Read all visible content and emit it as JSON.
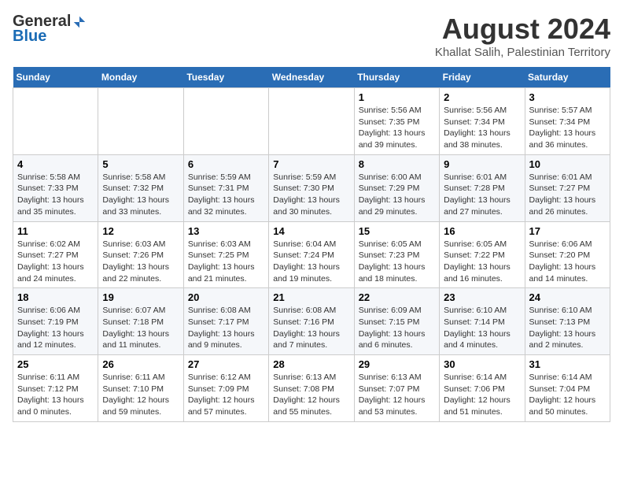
{
  "logo": {
    "general": "General",
    "blue": "Blue"
  },
  "header": {
    "month_title": "August 2024",
    "location": "Khallat Salih, Palestinian Territory"
  },
  "weekdays": [
    "Sunday",
    "Monday",
    "Tuesday",
    "Wednesday",
    "Thursday",
    "Friday",
    "Saturday"
  ],
  "weeks": [
    [
      {
        "day": "",
        "info": ""
      },
      {
        "day": "",
        "info": ""
      },
      {
        "day": "",
        "info": ""
      },
      {
        "day": "",
        "info": ""
      },
      {
        "day": "1",
        "info": "Sunrise: 5:56 AM\nSunset: 7:35 PM\nDaylight: 13 hours\nand 39 minutes."
      },
      {
        "day": "2",
        "info": "Sunrise: 5:56 AM\nSunset: 7:34 PM\nDaylight: 13 hours\nand 38 minutes."
      },
      {
        "day": "3",
        "info": "Sunrise: 5:57 AM\nSunset: 7:34 PM\nDaylight: 13 hours\nand 36 minutes."
      }
    ],
    [
      {
        "day": "4",
        "info": "Sunrise: 5:58 AM\nSunset: 7:33 PM\nDaylight: 13 hours\nand 35 minutes."
      },
      {
        "day": "5",
        "info": "Sunrise: 5:58 AM\nSunset: 7:32 PM\nDaylight: 13 hours\nand 33 minutes."
      },
      {
        "day": "6",
        "info": "Sunrise: 5:59 AM\nSunset: 7:31 PM\nDaylight: 13 hours\nand 32 minutes."
      },
      {
        "day": "7",
        "info": "Sunrise: 5:59 AM\nSunset: 7:30 PM\nDaylight: 13 hours\nand 30 minutes."
      },
      {
        "day": "8",
        "info": "Sunrise: 6:00 AM\nSunset: 7:29 PM\nDaylight: 13 hours\nand 29 minutes."
      },
      {
        "day": "9",
        "info": "Sunrise: 6:01 AM\nSunset: 7:28 PM\nDaylight: 13 hours\nand 27 minutes."
      },
      {
        "day": "10",
        "info": "Sunrise: 6:01 AM\nSunset: 7:27 PM\nDaylight: 13 hours\nand 26 minutes."
      }
    ],
    [
      {
        "day": "11",
        "info": "Sunrise: 6:02 AM\nSunset: 7:27 PM\nDaylight: 13 hours\nand 24 minutes."
      },
      {
        "day": "12",
        "info": "Sunrise: 6:03 AM\nSunset: 7:26 PM\nDaylight: 13 hours\nand 22 minutes."
      },
      {
        "day": "13",
        "info": "Sunrise: 6:03 AM\nSunset: 7:25 PM\nDaylight: 13 hours\nand 21 minutes."
      },
      {
        "day": "14",
        "info": "Sunrise: 6:04 AM\nSunset: 7:24 PM\nDaylight: 13 hours\nand 19 minutes."
      },
      {
        "day": "15",
        "info": "Sunrise: 6:05 AM\nSunset: 7:23 PM\nDaylight: 13 hours\nand 18 minutes."
      },
      {
        "day": "16",
        "info": "Sunrise: 6:05 AM\nSunset: 7:22 PM\nDaylight: 13 hours\nand 16 minutes."
      },
      {
        "day": "17",
        "info": "Sunrise: 6:06 AM\nSunset: 7:20 PM\nDaylight: 13 hours\nand 14 minutes."
      }
    ],
    [
      {
        "day": "18",
        "info": "Sunrise: 6:06 AM\nSunset: 7:19 PM\nDaylight: 13 hours\nand 12 minutes."
      },
      {
        "day": "19",
        "info": "Sunrise: 6:07 AM\nSunset: 7:18 PM\nDaylight: 13 hours\nand 11 minutes."
      },
      {
        "day": "20",
        "info": "Sunrise: 6:08 AM\nSunset: 7:17 PM\nDaylight: 13 hours\nand 9 minutes."
      },
      {
        "day": "21",
        "info": "Sunrise: 6:08 AM\nSunset: 7:16 PM\nDaylight: 13 hours\nand 7 minutes."
      },
      {
        "day": "22",
        "info": "Sunrise: 6:09 AM\nSunset: 7:15 PM\nDaylight: 13 hours\nand 6 minutes."
      },
      {
        "day": "23",
        "info": "Sunrise: 6:10 AM\nSunset: 7:14 PM\nDaylight: 13 hours\nand 4 minutes."
      },
      {
        "day": "24",
        "info": "Sunrise: 6:10 AM\nSunset: 7:13 PM\nDaylight: 13 hours\nand 2 minutes."
      }
    ],
    [
      {
        "day": "25",
        "info": "Sunrise: 6:11 AM\nSunset: 7:12 PM\nDaylight: 13 hours\nand 0 minutes."
      },
      {
        "day": "26",
        "info": "Sunrise: 6:11 AM\nSunset: 7:10 PM\nDaylight: 12 hours\nand 59 minutes."
      },
      {
        "day": "27",
        "info": "Sunrise: 6:12 AM\nSunset: 7:09 PM\nDaylight: 12 hours\nand 57 minutes."
      },
      {
        "day": "28",
        "info": "Sunrise: 6:13 AM\nSunset: 7:08 PM\nDaylight: 12 hours\nand 55 minutes."
      },
      {
        "day": "29",
        "info": "Sunrise: 6:13 AM\nSunset: 7:07 PM\nDaylight: 12 hours\nand 53 minutes."
      },
      {
        "day": "30",
        "info": "Sunrise: 6:14 AM\nSunset: 7:06 PM\nDaylight: 12 hours\nand 51 minutes."
      },
      {
        "day": "31",
        "info": "Sunrise: 6:14 AM\nSunset: 7:04 PM\nDaylight: 12 hours\nand 50 minutes."
      }
    ]
  ]
}
